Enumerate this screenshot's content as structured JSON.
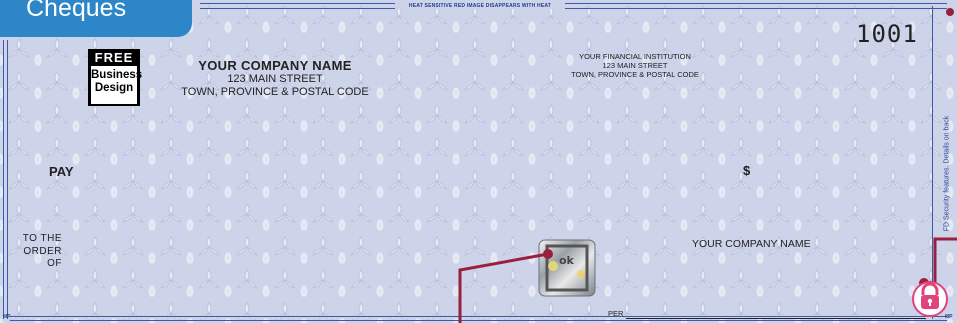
{
  "tab": {
    "label": "Cheques"
  },
  "cheque": {
    "number": "1001",
    "heat_text": "HEAT SENSITIVE RED IMAGE DISAPPEARS WITH HEAT",
    "logo": {
      "top": "FREE",
      "line1": "Business",
      "line2": "Design"
    },
    "company": {
      "name": "YOUR COMPANY NAME",
      "street": "123 MAIN STREET",
      "city": "TOWN, PROVINCE & POSTAL CODE"
    },
    "bank": {
      "name": "YOUR FINANCIAL INSTITUTION",
      "street": "123 MAIN STREET",
      "city": "TOWN, PROVINCE & POSTAL CODE"
    },
    "pay_label": "PAY",
    "dollar_sign": "$",
    "order_lines": [
      "TO THE",
      "ORDER",
      "OF"
    ],
    "signer_name": "YOUR COMPANY NAME",
    "per_label": "PER",
    "side_text": "FD Security features. Details on back",
    "microprint_left": "MP",
    "microprint_right": "MP"
  },
  "colors": {
    "tab": "#2c86c8",
    "background": "#cdd3e8",
    "pattern": "#e6e9f4",
    "callout": "#9a1f3c"
  },
  "icons": [
    "security-lock-icon",
    "hologram-ok-icon"
  ]
}
